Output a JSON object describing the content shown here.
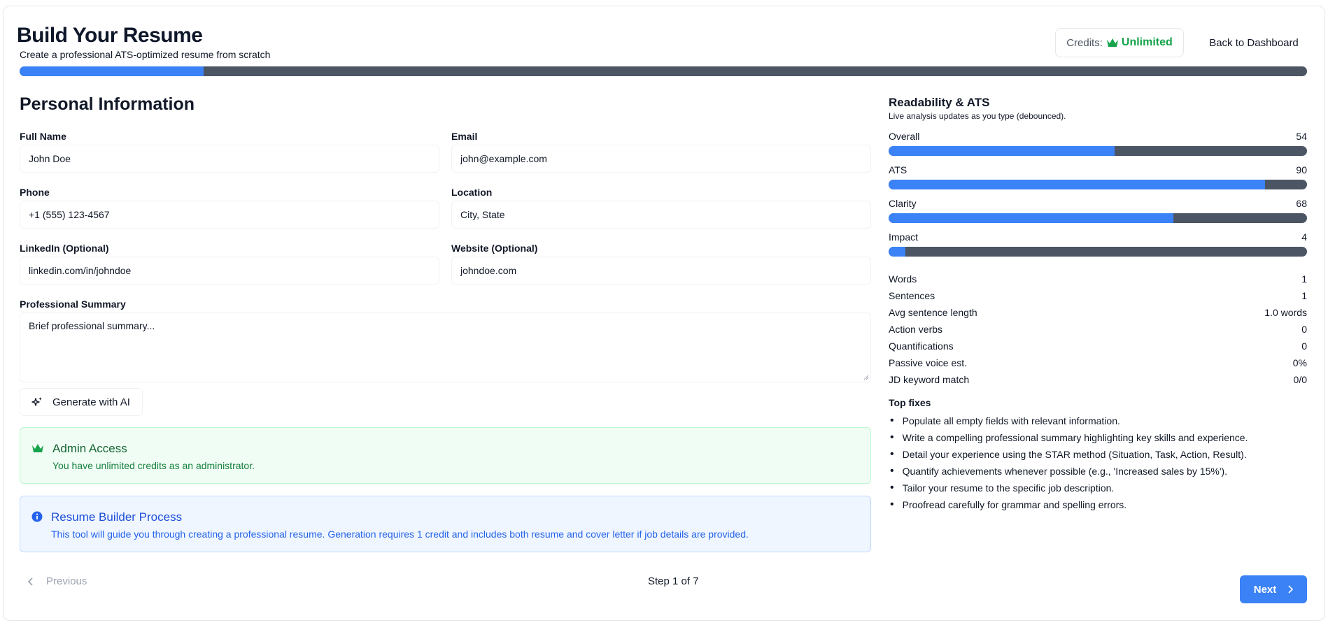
{
  "header": {
    "title": "Build Your Resume",
    "subtitle": "Create a professional ATS-optimized resume from scratch",
    "credits_label": "Credits:",
    "credits_value": "Unlimited",
    "back_label": "Back to Dashboard",
    "progress_fraction": 0.143
  },
  "form": {
    "section_title": "Personal Information",
    "full_name_label": "Full Name",
    "full_name_value": "John Doe",
    "email_label": "Email",
    "email_value": "john@example.com",
    "phone_label": "Phone",
    "phone_value": "+1 (555) 123-4567",
    "location_label": "Location",
    "location_value": "City, State",
    "linkedin_label": "LinkedIn (Optional)",
    "linkedin_value": "linkedin.com/in/johndoe",
    "website_label": "Website (Optional)",
    "website_value": "johndoe.com",
    "summary_label": "Professional Summary",
    "summary_value": "Brief professional summary...",
    "generate_label": "Generate with AI"
  },
  "alerts": {
    "admin_title": "Admin Access",
    "admin_body": "You have unlimited credits as an administrator.",
    "process_title": "Resume Builder Process",
    "process_body": "This tool will guide you through creating a professional resume. Generation requires 1 credit and includes both resume and cover letter if job details are provided."
  },
  "nav": {
    "previous_label": "Previous",
    "step_text": "Step 1 of 7",
    "next_label": "Next"
  },
  "analysis": {
    "title": "Readability & ATS",
    "subtitle": "Live analysis updates as you type (debounced).",
    "metrics": [
      {
        "label": "Overall",
        "value": "54",
        "fraction": 0.54
      },
      {
        "label": "ATS",
        "value": "90",
        "fraction": 0.9
      },
      {
        "label": "Clarity",
        "value": "68",
        "fraction": 0.68
      },
      {
        "label": "Impact",
        "value": "4",
        "fraction": 0.04
      }
    ],
    "stats": [
      {
        "label": "Words",
        "value": "1"
      },
      {
        "label": "Sentences",
        "value": "1"
      },
      {
        "label": "Avg sentence length",
        "value": "1.0 words"
      },
      {
        "label": "Action verbs",
        "value": "0"
      },
      {
        "label": "Quantifications",
        "value": "0"
      },
      {
        "label": "Passive voice est.",
        "value": "0%"
      },
      {
        "label": "JD keyword match",
        "value": "0/0"
      }
    ],
    "fixes_title": "Top fixes",
    "fixes": [
      "Populate all empty fields with relevant information.",
      "Write a compelling professional summary highlighting key skills and experience.",
      "Detail your experience using the STAR method (Situation, Task, Action, Result).",
      "Quantify achievements whenever possible (e.g., 'Increased sales by 15%').",
      "Tailor your resume to the specific job description.",
      "Proofread carefully for grammar and spelling errors."
    ]
  },
  "colors": {
    "accent": "#3b82f6",
    "track": "#4b5563",
    "success": "#16a34a"
  }
}
